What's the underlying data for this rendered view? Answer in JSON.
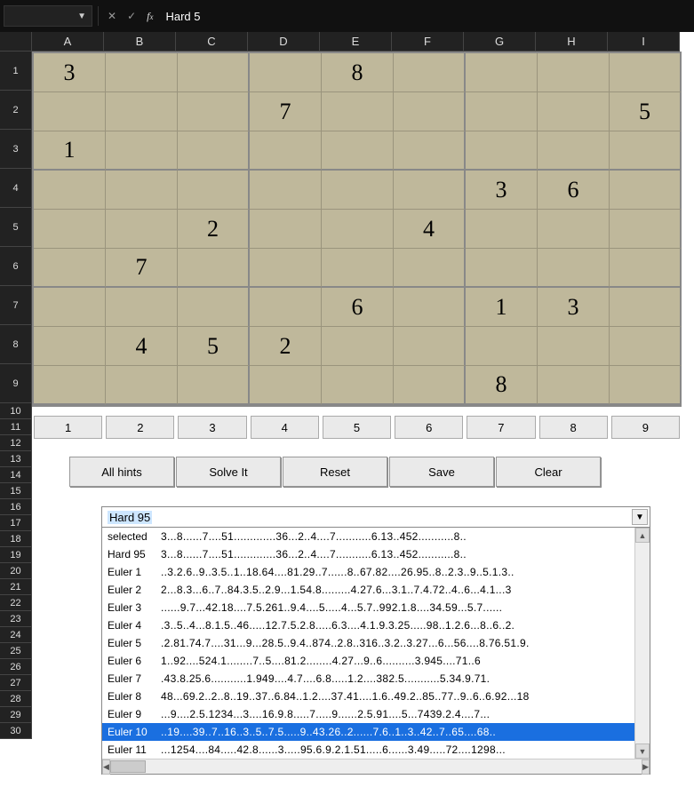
{
  "formula_bar": {
    "name_box": "",
    "formula_value": "Hard 5"
  },
  "columns": [
    "A",
    "B",
    "C",
    "D",
    "E",
    "F",
    "G",
    "H",
    "I"
  ],
  "row_heights": {
    "tall": 44,
    "short": 18
  },
  "rows_tall": [
    "1",
    "2",
    "3",
    "4",
    "5",
    "6",
    "7",
    "8",
    "9"
  ],
  "rows_short": [
    "10",
    "11",
    "12",
    "13",
    "14",
    "15",
    "16",
    "17",
    "18",
    "19",
    "20",
    "21",
    "22",
    "23",
    "24",
    "25",
    "26",
    "27",
    "28",
    "29",
    "30"
  ],
  "sudoku": [
    [
      "3",
      "",
      "",
      "",
      "8",
      "",
      "",
      "",
      ""
    ],
    [
      "",
      "",
      "",
      "7",
      "",
      "",
      "",
      "",
      "5"
    ],
    [
      "1",
      "",
      "",
      "",
      "",
      "",
      "",
      "",
      ""
    ],
    [
      "",
      "",
      "",
      "",
      "",
      "",
      "3",
      "6",
      ""
    ],
    [
      "",
      "",
      "2",
      "",
      "",
      "4",
      "",
      "",
      ""
    ],
    [
      "",
      "7",
      "",
      "",
      "",
      "",
      "",
      "",
      ""
    ],
    [
      "",
      "",
      "",
      "",
      "6",
      "",
      "1",
      "3",
      ""
    ],
    [
      "",
      "4",
      "5",
      "2",
      "",
      "",
      "",
      "",
      ""
    ],
    [
      "",
      "",
      "",
      "",
      "",
      "",
      "8",
      "",
      ""
    ]
  ],
  "num_buttons": [
    "1",
    "2",
    "3",
    "4",
    "5",
    "6",
    "7",
    "8",
    "9"
  ],
  "actions": {
    "hints": "All hints",
    "solve": "Solve It",
    "reset": "Reset",
    "save": "Save",
    "clear": "Clear"
  },
  "dropdown": {
    "selected_label": "Hard 95",
    "rows": [
      {
        "label": "selected",
        "value": "3...8......7....51.............36...2..4....7...........6.13..452...........8.."
      },
      {
        "label": "Hard 95",
        "value": "3...8......7....51.............36...2..4....7...........6.13..452...........8.."
      },
      {
        "label": "Euler 1",
        "value": "..3.2.6..9..3.5..1..18.64....81.29..7......8..67.82....26.95..8..2.3..9..5.1.3.."
      },
      {
        "label": "Euler 2",
        "value": "2...8.3...6..7..84.3.5..2.9...1.54.8.........4.27.6...3.1..7.4.72..4..6...4.1...3"
      },
      {
        "label": "Euler 3",
        "value": "......9.7...42.18....7.5.261..9.4....5.....4...5.7..992.1.8....34.59...5.7......"
      },
      {
        "label": "Euler 4",
        "value": ".3..5..4...8.1.5..46.....12.7.5.2.8.....6.3....4.1.9.3.25.....98..1.2.6...8..6..2."
      },
      {
        "label": "Euler 5",
        "value": ".2.81.74.7....31...9...28.5..9.4..874..2.8..316..3.2..3.27...6...56....8.76.51.9."
      },
      {
        "label": "Euler 6",
        "value": "1..92....524.1........7..5....81.2........4.27...9..6..........3.945....71..6"
      },
      {
        "label": "Euler 7",
        "value": ".43.8.25.6...........1.949....4.7....6.8.....1.2....382.5...........5.34.9.71."
      },
      {
        "label": "Euler 8",
        "value": "48...69.2..2..8..19..37..6.84..1.2....37.41....1.6..49.2..85..77..9..6..6.92...18"
      },
      {
        "label": "Euler 9",
        "value": "...9....2.5.1234...3....16.9.8.....7.....9......2.5.91....5...7439.2.4....7..."
      },
      {
        "label": "Euler 10",
        "value": "..19....39..7..16..3..5..7.5.....9..43.26..2......7.6..1..3..42..7..65....68.."
      },
      {
        "label": "Euler 11",
        "value": "...1254....84.....42.8......3.....95.6.9.2.1.51.....6......3.49.....72....1298..."
      }
    ],
    "highlighted_index": 11
  }
}
